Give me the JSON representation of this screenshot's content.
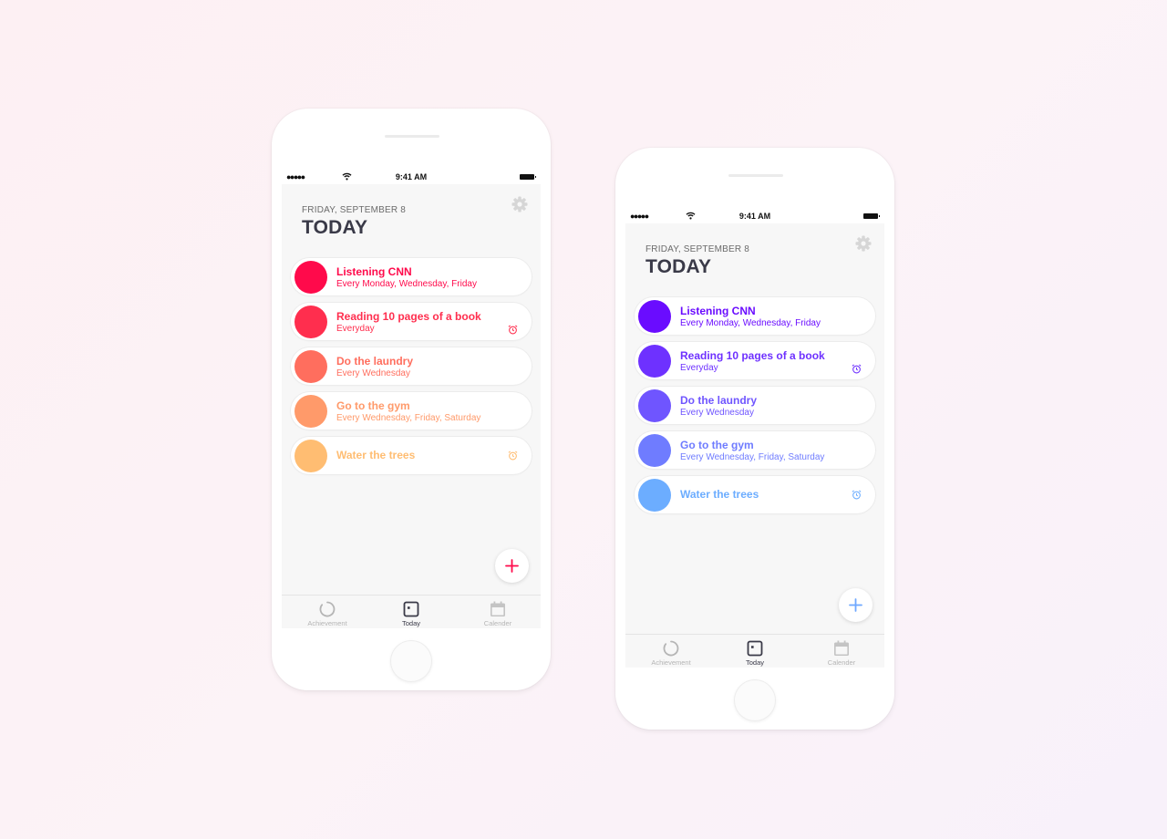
{
  "phones": [
    {
      "status": {
        "signal": "●●●●●",
        "time": "9:41 AM"
      },
      "header": {
        "date": "FRIDAY, SEPTEMBER 8",
        "title": "TODAY"
      },
      "settings_icon": "gear-icon",
      "accent": "#ff0a4b",
      "tasks": [
        {
          "title": "Listening CNN",
          "subtitle": "Every Monday, Wednesday, Friday",
          "color": "#ff0a4b",
          "alarm": false
        },
        {
          "title": "Reading 10 pages of a book",
          "subtitle": "Everyday",
          "color": "#ff2e4e",
          "alarm": true
        },
        {
          "title": "Do the laundry",
          "subtitle": "Every Wednesday",
          "color": "#ff6e5e",
          "alarm": false
        },
        {
          "title": "Go to the gym",
          "subtitle": "Every Wednesday, Friday, Saturday",
          "color": "#ff9a6a",
          "alarm": false
        },
        {
          "title": "Water the trees",
          "subtitle": "",
          "color": "#ffbd72",
          "alarm": true
        }
      ],
      "add_icon": "plus-icon",
      "tabs": [
        {
          "label": "Achievement",
          "icon": "progress-ring-icon",
          "active": false
        },
        {
          "label": "Today",
          "icon": "today-square-icon",
          "active": true
        },
        {
          "label": "Calender",
          "icon": "calendar-icon",
          "active": false
        }
      ]
    },
    {
      "status": {
        "signal": "●●●●●",
        "time": "9:41 AM"
      },
      "header": {
        "date": "FRIDAY, SEPTEMBER 8",
        "title": "TODAY"
      },
      "settings_icon": "gear-icon",
      "accent": "#6fa8ff",
      "tasks": [
        {
          "title": "Listening CNN",
          "subtitle": "Every Monday, Wednesday, Friday",
          "color": "#6a0cff",
          "alarm": false
        },
        {
          "title": "Reading 10 pages of a book",
          "subtitle": "Everyday",
          "color": "#6e31ff",
          "alarm": true
        },
        {
          "title": "Do the laundry",
          "subtitle": "Every Wednesday",
          "color": "#6f55ff",
          "alarm": false
        },
        {
          "title": "Go to the gym",
          "subtitle": "Every Wednesday, Friday, Saturday",
          "color": "#6f7cff",
          "alarm": false
        },
        {
          "title": "Water the trees",
          "subtitle": "",
          "color": "#6cadff",
          "alarm": true
        }
      ],
      "add_icon": "plus-icon",
      "tabs": [
        {
          "label": "Achievement",
          "icon": "progress-ring-icon",
          "active": false
        },
        {
          "label": "Today",
          "icon": "today-square-icon",
          "active": true
        },
        {
          "label": "Calender",
          "icon": "calendar-icon",
          "active": false
        }
      ]
    }
  ]
}
